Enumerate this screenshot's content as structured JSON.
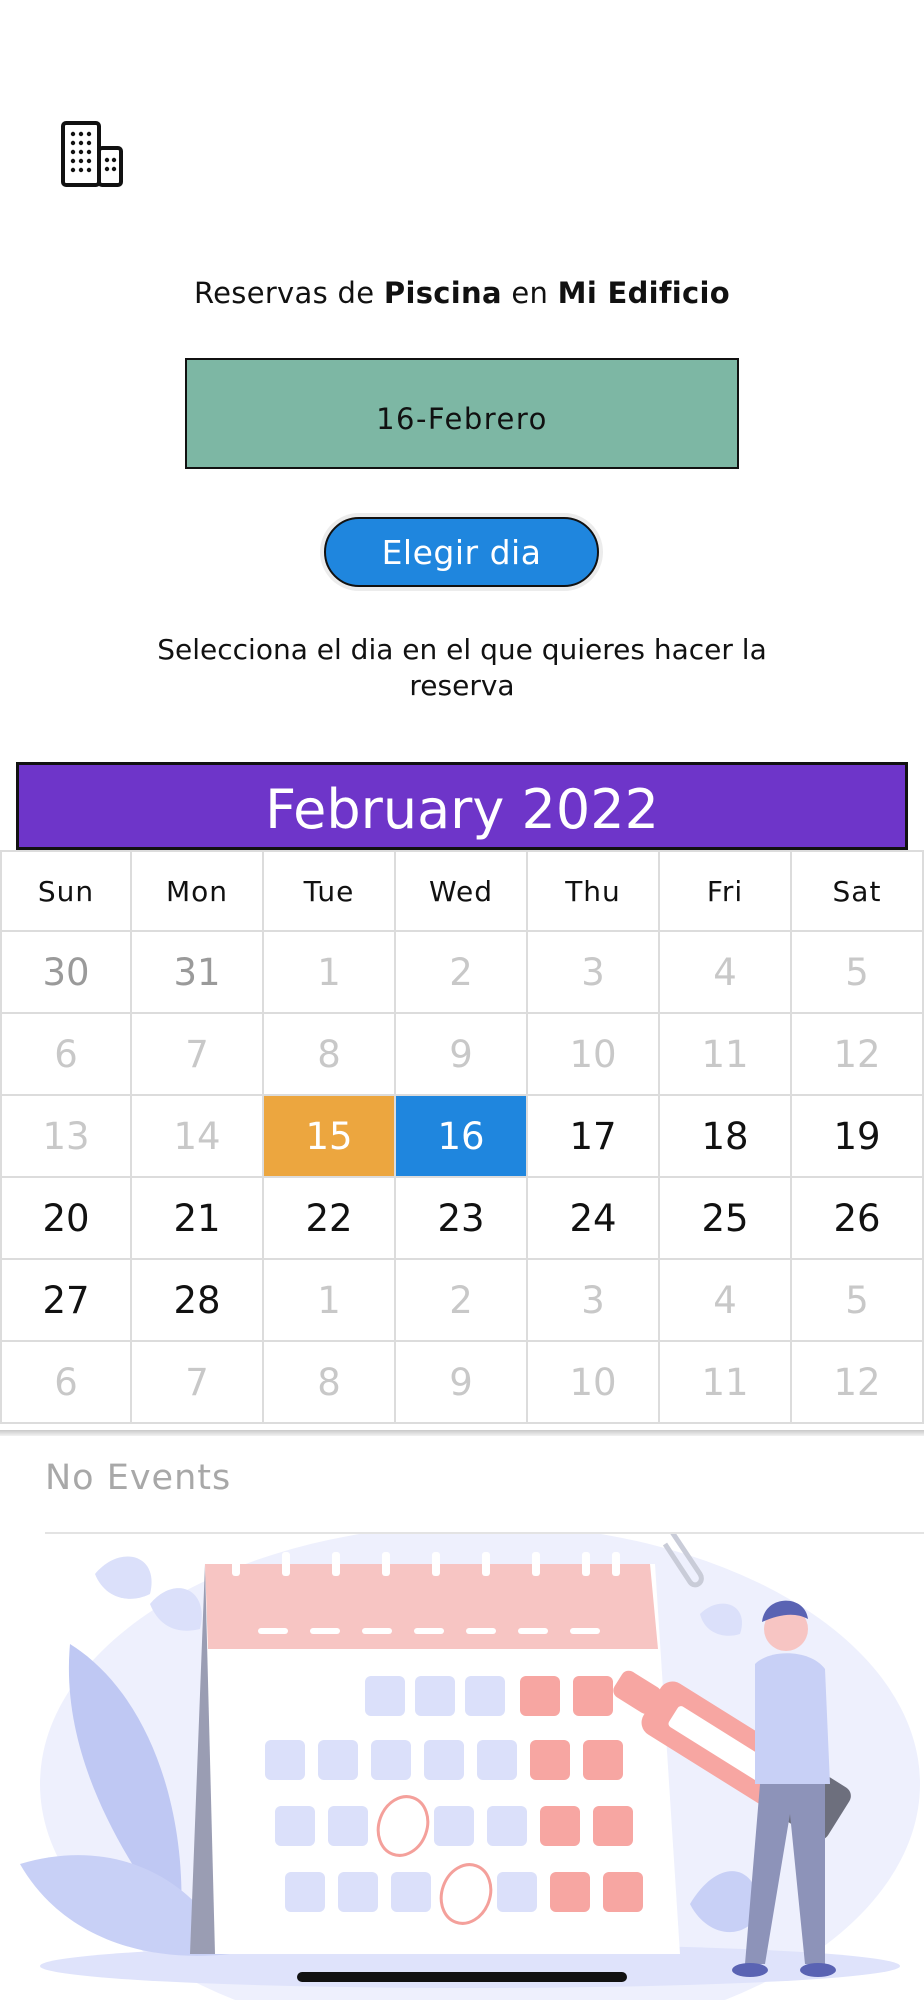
{
  "header": {
    "icon": "building-icon",
    "title_prefix": "Reservas de ",
    "title_facility": "Piscina",
    "title_middle": " en ",
    "title_building": "Mi Edificio"
  },
  "selected_date_label": "16-Febrero",
  "choose_button_label": "Elegir dia",
  "instruction_text": "Selecciona el dia en el que quieres hacer la reserva",
  "calendar": {
    "month_title": "February 2022",
    "weekdays": [
      "Sun",
      "Mon",
      "Tue",
      "Wed",
      "Thu",
      "Fri",
      "Sat"
    ],
    "weeks": [
      [
        "30",
        "31",
        "1",
        "2",
        "3",
        "4",
        "5"
      ],
      [
        "6",
        "7",
        "8",
        "9",
        "10",
        "11",
        "12"
      ],
      [
        "13",
        "14",
        "15",
        "16",
        "17",
        "18",
        "19"
      ],
      [
        "20",
        "21",
        "22",
        "23",
        "24",
        "25",
        "26"
      ],
      [
        "27",
        "28",
        "1",
        "2",
        "3",
        "4",
        "5"
      ],
      [
        "6",
        "7",
        "8",
        "9",
        "10",
        "11",
        "12"
      ]
    ],
    "today": "15",
    "selected": "16",
    "colors": {
      "header": "#6e35c9",
      "today": "#eca63f",
      "selected": "#1f86de"
    }
  },
  "events": {
    "empty_text": "No Events"
  },
  "colors": {
    "date_box": "#7db7a4",
    "button": "#1f86de"
  }
}
